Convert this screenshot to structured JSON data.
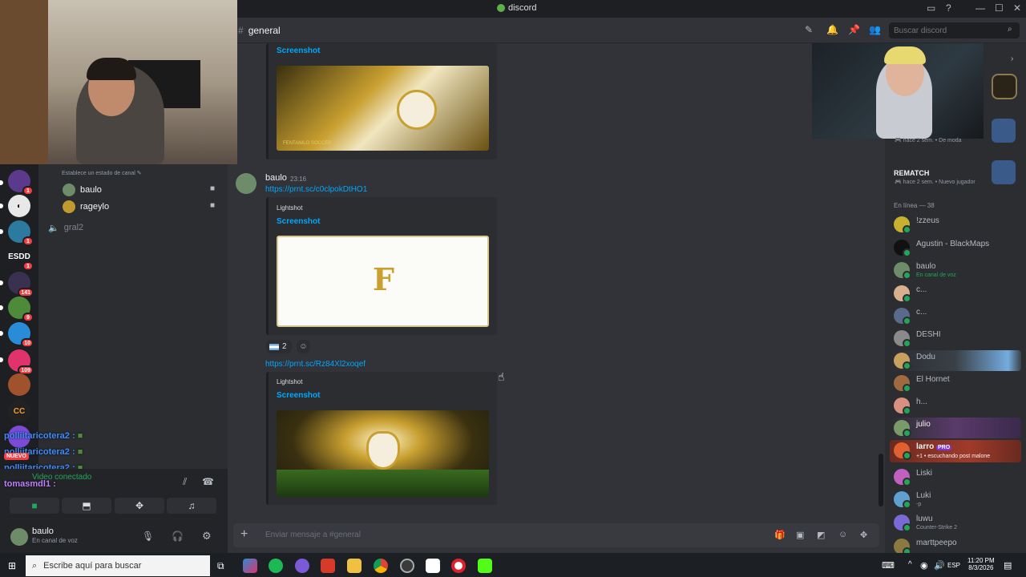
{
  "app": {
    "title": "discord"
  },
  "header": {
    "channel": "general",
    "search_placeholder": "Buscar discord"
  },
  "servers": [
    {
      "badge": "1"
    },
    {
      "badge": ""
    },
    {
      "badge": "1"
    },
    {
      "label": "ESDD",
      "badge": "1"
    },
    {
      "badge": "141"
    },
    {
      "badge": "9"
    },
    {
      "badge": "10"
    },
    {
      "badge": "109"
    },
    {
      "badge": ""
    },
    {
      "badge": ""
    }
  ],
  "channels": {
    "status_hint": "Establece un estado de canal",
    "voice_users": [
      "baulo",
      "rageylo"
    ],
    "other_channel": "gral2"
  },
  "overlay_chat": [
    {
      "user": "polliitaricotera2",
      "sep": ":"
    },
    {
      "user": "polliitaricotera2",
      "sep": ":"
    },
    {
      "user": "polliitaricotera2",
      "sep": ":"
    },
    {
      "user": "tomasmdl1",
      "sep": ":"
    }
  ],
  "voice_panel": {
    "status": "Video conectado",
    "new_badge": "NUEVO"
  },
  "user_panel": {
    "name": "baulo",
    "status": "En canal de voz"
  },
  "messages": {
    "embed1_title": "Screenshot",
    "author": "baulo",
    "time": "23:16",
    "link1": "https://prnt.sc/c0clpokDtHO1",
    "embed2_provider": "Lightshot",
    "embed2_title": "Screenshot",
    "reaction_count": "2",
    "link2": "https://prnt.sc/Rz84Xl2xoqef",
    "embed3_provider": "Lightshot",
    "embed3_title": "Screenshot",
    "banner_brand": "FENTANILO SOCCER"
  },
  "composer": {
    "placeholder": "Enviar mensaje a #general"
  },
  "members": {
    "activity1": {
      "time": "hace 2 sem.",
      "tag": "De moda"
    },
    "activity2": {
      "title": "REMATCH",
      "time": "hace 2 sem.",
      "tag": "Nuevo jugador"
    },
    "online_header": "En línea — 38",
    "list": [
      {
        "name": "!zzeus",
        "sub": ""
      },
      {
        "name": "Agustin - BlackMaps",
        "sub": ""
      },
      {
        "name": "baulo",
        "sub": "En canal de voz"
      },
      {
        "name": "c...",
        "sub": ""
      },
      {
        "name": "c...",
        "sub": ""
      },
      {
        "name": "DESHI",
        "sub": ""
      },
      {
        "name": "Dodu",
        "sub": ""
      },
      {
        "name": "El Hornet",
        "sub": ""
      },
      {
        "name": "h...",
        "sub": ""
      },
      {
        "name": "julio",
        "sub": ""
      },
      {
        "name": "larro",
        "badge": "PRO",
        "sub": "+1 • escuchando post malone"
      },
      {
        "name": "Liski",
        "sub": ""
      },
      {
        "name": "Luki",
        "sub": "-p"
      },
      {
        "name": "luwu",
        "sub": "Counter-Strike 2"
      },
      {
        "name": "marttpeepo",
        "sub": ""
      }
    ]
  },
  "taskbar": {
    "search_placeholder": "Escribe aquí para buscar",
    "language": "ESP",
    "time": "11:20 PM",
    "date": "8/3/2026"
  },
  "colors": {
    "link": "#00a8fc",
    "online": "#23a55a",
    "mention_red": "#f23f43"
  }
}
